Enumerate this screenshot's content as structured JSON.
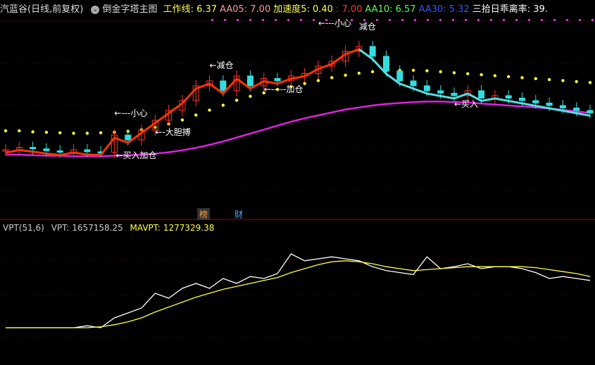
{
  "header": {
    "stock_name": "汽蓝谷",
    "period": "(日线,前复权)",
    "indicator_name": "倒金字塔主图",
    "items": [
      {
        "label": "工作线",
        "value": "6.37",
        "color": "#ffff55"
      },
      {
        "label": "AA05",
        "value": "7.00",
        "color": "#ff9999"
      },
      {
        "label": "加速度5",
        "value": "0.40",
        "color": "#ffff55"
      },
      {
        "label": "",
        "value": "7.00",
        "color": "#ff3333"
      },
      {
        "label": "AA10",
        "value": "6.57",
        "color": "#55ff55"
      },
      {
        "label": "AA30",
        "value": "5.32",
        "color": "#3355ff"
      },
      {
        "label": "三拾日乖离率",
        "value": "39.",
        "color": "#ffffff"
      }
    ]
  },
  "buttons": {
    "bang": "榜",
    "cai": "财"
  },
  "sub_header": {
    "name": "VPT(51,6)",
    "vpt_label": "VPT:",
    "vpt_value": "1657158.25",
    "mavpt_label": "MAVPT:",
    "mavpt_value": "1277329.38"
  },
  "annotations": [
    {
      "text": "←买入加仓",
      "color": "#ffffff"
    },
    {
      "text": "←-大胆搏",
      "color": "#ffffff"
    },
    {
      "text": "←---小心",
      "color": "#ffffff"
    },
    {
      "text": "←减仓",
      "color": "#ffffff"
    },
    {
      "text": "←-----加仓",
      "color": "#ffffff"
    },
    {
      "text": "←---小心",
      "color": "#ffffff"
    },
    {
      "text": "减仓",
      "color": "#ffffff"
    },
    {
      "text": "←买入",
      "color": "#ffffff"
    }
  ],
  "chart_data": [
    {
      "type": "candlestick",
      "title": "倒金字塔主图",
      "series": [
        {
          "name": "MA30",
          "color": "#e020e0",
          "values": [
            6.0,
            6.0,
            5.99,
            5.98,
            5.98,
            5.97,
            5.97,
            5.97,
            5.98,
            5.99,
            6.0,
            6.02,
            6.05,
            6.09,
            6.14,
            6.2,
            6.27,
            6.35,
            6.43,
            6.51,
            6.59,
            6.67,
            6.74,
            6.8,
            6.86,
            6.92,
            6.96,
            7.0,
            7.03,
            7.05,
            7.07,
            7.08,
            7.08,
            7.07,
            7.06,
            7.04,
            7.02,
            7.0,
            6.98,
            6.96,
            6.94,
            6.91,
            6.88,
            6.85
          ]
        },
        {
          "name": "工作线",
          "color": "#ffff33",
          "values": [
            6.2,
            6.2,
            6.18,
            6.17,
            6.16,
            6.15,
            6.15,
            6.16,
            6.17,
            6.19,
            6.22,
            6.27,
            6.34,
            6.42,
            6.52,
            6.62,
            6.72,
            6.82,
            6.9,
            6.97,
            7.04,
            7.1,
            7.16,
            7.22,
            7.28,
            7.33,
            7.37,
            7.4,
            7.42,
            7.43,
            7.43,
            7.42,
            7.4,
            7.38,
            7.36,
            7.34,
            7.32,
            7.3,
            7.28,
            7.26,
            7.24,
            7.22,
            7.2,
            7.18
          ]
        }
      ],
      "candles": [
        6.1,
        6.15,
        6.12,
        6.08,
        6.05,
        6.1,
        6.06,
        6.05,
        6.4,
        6.3,
        6.5,
        6.7,
        6.9,
        7.1,
        7.4,
        7.5,
        7.3,
        7.6,
        7.4,
        7.55,
        7.5,
        7.6,
        7.65,
        7.8,
        7.9,
        8.1,
        8.2,
        8.0,
        7.7,
        7.5,
        7.4,
        7.3,
        7.25,
        7.2,
        7.3,
        7.15,
        7.2,
        7.15,
        7.1,
        7.05,
        7.0,
        6.95,
        6.9,
        6.85
      ]
    },
    {
      "type": "line",
      "title": "VPT(51,6)",
      "series": [
        {
          "name": "VPT",
          "color": "#ffffff",
          "values": [
            0.1,
            0.1,
            0.1,
            0.1,
            0.1,
            0.1,
            0.12,
            0.1,
            0.2,
            0.25,
            0.3,
            0.45,
            0.4,
            0.5,
            0.55,
            0.5,
            0.6,
            0.55,
            0.62,
            0.6,
            0.65,
            0.85,
            0.78,
            0.8,
            0.82,
            0.8,
            0.78,
            0.72,
            0.68,
            0.66,
            0.64,
            0.82,
            0.7,
            0.72,
            0.75,
            0.7,
            0.72,
            0.72,
            0.7,
            0.66,
            0.6,
            0.62,
            0.6,
            0.58
          ]
        },
        {
          "name": "MAVPT",
          "color": "#ffff44",
          "values": [
            0.1,
            0.1,
            0.1,
            0.1,
            0.1,
            0.1,
            0.1,
            0.11,
            0.13,
            0.16,
            0.2,
            0.26,
            0.31,
            0.36,
            0.41,
            0.45,
            0.49,
            0.52,
            0.55,
            0.58,
            0.61,
            0.66,
            0.7,
            0.74,
            0.77,
            0.78,
            0.77,
            0.75,
            0.72,
            0.7,
            0.68,
            0.69,
            0.7,
            0.71,
            0.72,
            0.72,
            0.72,
            0.72,
            0.72,
            0.71,
            0.69,
            0.67,
            0.65,
            0.62
          ]
        }
      ]
    }
  ]
}
